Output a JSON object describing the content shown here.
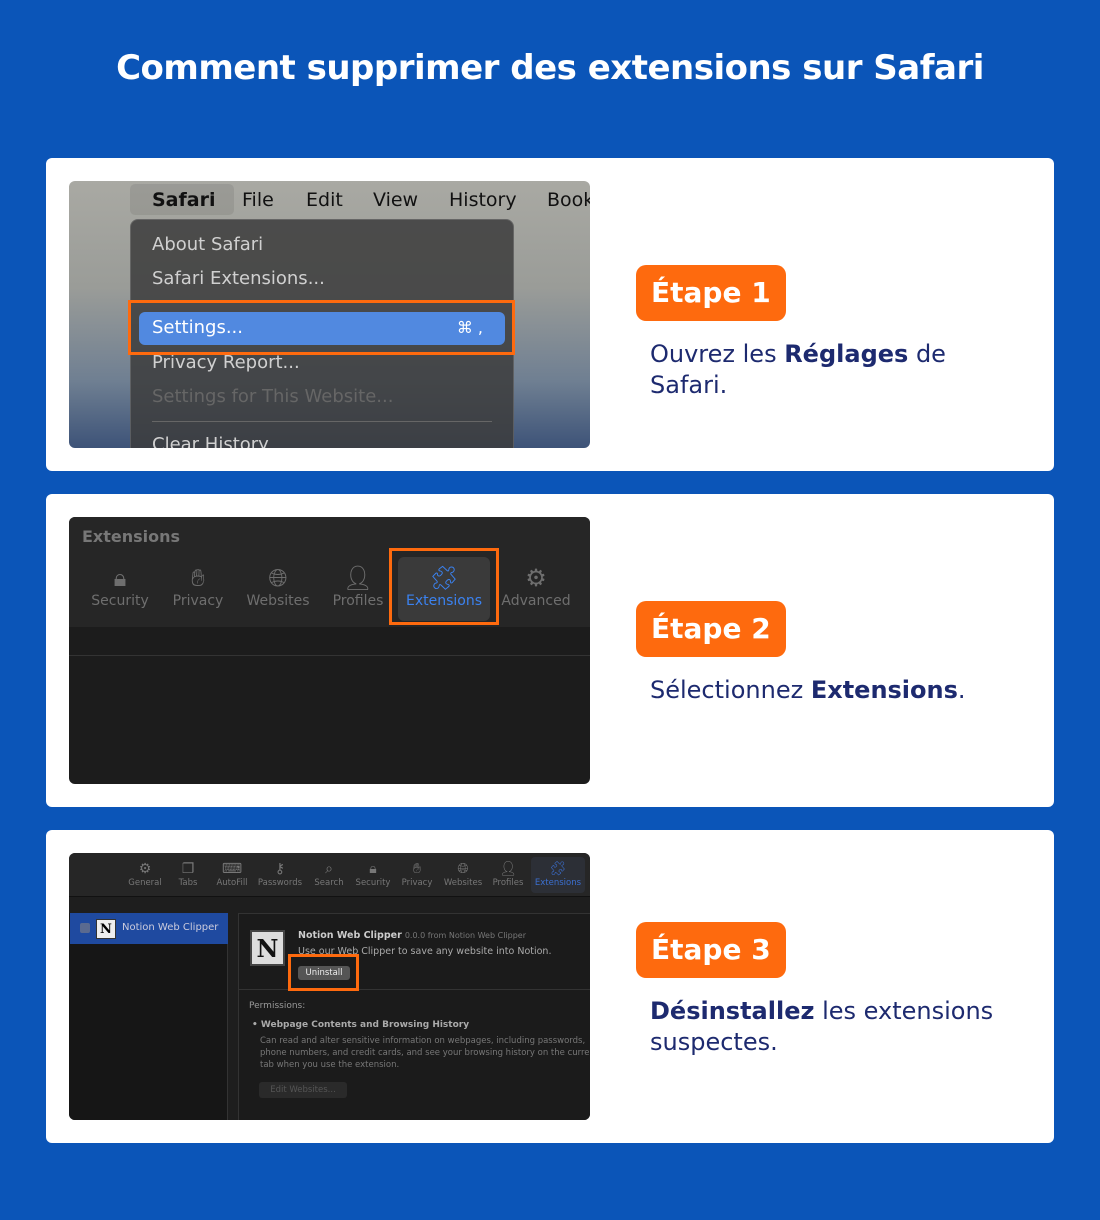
{
  "title": "Comment supprimer des extensions sur Safari",
  "colors": {
    "background": "#0b55b8",
    "accent": "#fe6a0e",
    "text": "#1d2a6f",
    "selection": "#5189e0"
  },
  "steps": [
    {
      "badge": "Étape 1",
      "desc_pre": "Ouvrez les ",
      "desc_bold": "Réglages",
      "desc_post": " de Safari."
    },
    {
      "badge": "Étape 2",
      "desc_pre": "Sélectionnez ",
      "desc_bold": "Extensions",
      "desc_post": "."
    },
    {
      "badge": "Étape 3",
      "desc_pre": "",
      "desc_bold": "Désinstallez",
      "desc_post": " les extensions suspectes."
    }
  ],
  "shot1": {
    "menubar": [
      "Safari",
      "File",
      "Edit",
      "View",
      "History",
      "Book"
    ],
    "menu": [
      "About Safari",
      "Safari Extensions...",
      "Settings...",
      "Privacy Report...",
      "Settings for This Website...",
      "Clear History"
    ],
    "shortcut": "⌘ ,"
  },
  "shot2": {
    "heading": "Extensions",
    "tabs": [
      "Security",
      "Privacy",
      "Websites",
      "Profiles",
      "Extensions",
      "Advanced"
    ]
  },
  "shot3": {
    "tabs": [
      "General",
      "Tabs",
      "AutoFill",
      "Passwords",
      "Search",
      "Security",
      "Privacy",
      "Websites",
      "Profiles",
      "Extensions"
    ],
    "ext_name": "Notion Web Clipper",
    "version": "0.0.0 from Notion Web Clipper",
    "ext_desc": "Use our Web Clipper to save any website into Notion.",
    "uninstall": "Uninstall",
    "permissions": "Permissions:",
    "perm_title": "Webpage Contents and Browsing History",
    "perm_desc": "Can read and alter sensitive information on webpages, including passwords, phone numbers, and credit cards, and see your browsing history on the current tab when you use the extension.",
    "edit_websites": "Edit Websites..."
  }
}
